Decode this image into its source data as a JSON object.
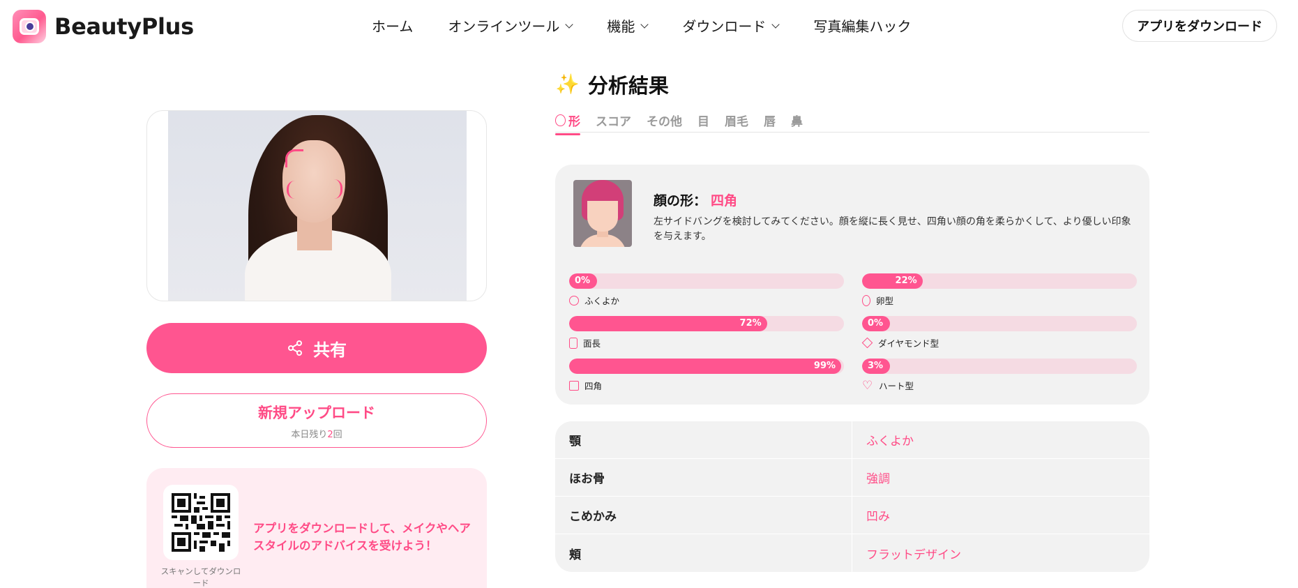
{
  "header": {
    "logo_text": "BeautyPlus",
    "nav": [
      {
        "label": "ホーム",
        "dropdown": false
      },
      {
        "label": "オンラインツール",
        "dropdown": true
      },
      {
        "label": "機能",
        "dropdown": true
      },
      {
        "label": "ダウンロード",
        "dropdown": true
      },
      {
        "label": "写真編集ハック",
        "dropdown": false
      }
    ],
    "download_app_label": "アプリをダウンロード"
  },
  "left": {
    "share_label": "共有",
    "upload_label": "新規アップロード",
    "upload_remaining_prefix": "本日残り",
    "upload_remaining_count": "2",
    "upload_remaining_suffix": "回",
    "qr_caption": "スキャンしてダウンロード",
    "promo_text": "アプリをダウンロードして、メイクやヘアスタイルのアドバイスを受けよう！"
  },
  "result": {
    "title": "分析結果",
    "tabs": [
      {
        "label": "形",
        "active": true
      },
      {
        "label": "スコア",
        "active": false
      },
      {
        "label": "その他",
        "active": false
      },
      {
        "label": "目",
        "active": false
      },
      {
        "label": "眉毛",
        "active": false
      },
      {
        "label": "唇",
        "active": false
      },
      {
        "label": "鼻",
        "active": false
      }
    ],
    "shape_label": "顔の形：",
    "shape_value": "四角",
    "shape_desc": "左サイドバングを検討してみてください。顔を縦に長く見せ、四角い顔の角を柔らかくして、より優しい印象を与えます。",
    "bars": [
      {
        "label": "ふくよか",
        "pct": 0,
        "pct_text": "0%",
        "icon": "round-face-icon"
      },
      {
        "label": "卵型",
        "pct": 22,
        "pct_text": "22%",
        "icon": "oval-face-icon"
      },
      {
        "label": "面長",
        "pct": 72,
        "pct_text": "72%",
        "icon": "long-face-icon"
      },
      {
        "label": "ダイヤモンド型",
        "pct": 0,
        "pct_text": "0%",
        "icon": "diamond-face-icon"
      },
      {
        "label": "四角",
        "pct": 99,
        "pct_text": "99%",
        "icon": "square-face-icon"
      },
      {
        "label": "ハート型",
        "pct": 3,
        "pct_text": "3%",
        "icon": "heart-face-icon"
      }
    ],
    "details": [
      {
        "key": "顎",
        "value": "ふくよか"
      },
      {
        "key": "ほお骨",
        "value": "強調"
      },
      {
        "key": "こめかみ",
        "value": "凹み"
      },
      {
        "key": "頬",
        "value": "フラットデザイン"
      }
    ]
  },
  "colors": {
    "accent": "#ff5590",
    "accent_text": "#ff4b86",
    "card_bg": "#f2f2f2",
    "bar_track": "#f5dbe3",
    "promo_bg": "#ffecf2"
  }
}
